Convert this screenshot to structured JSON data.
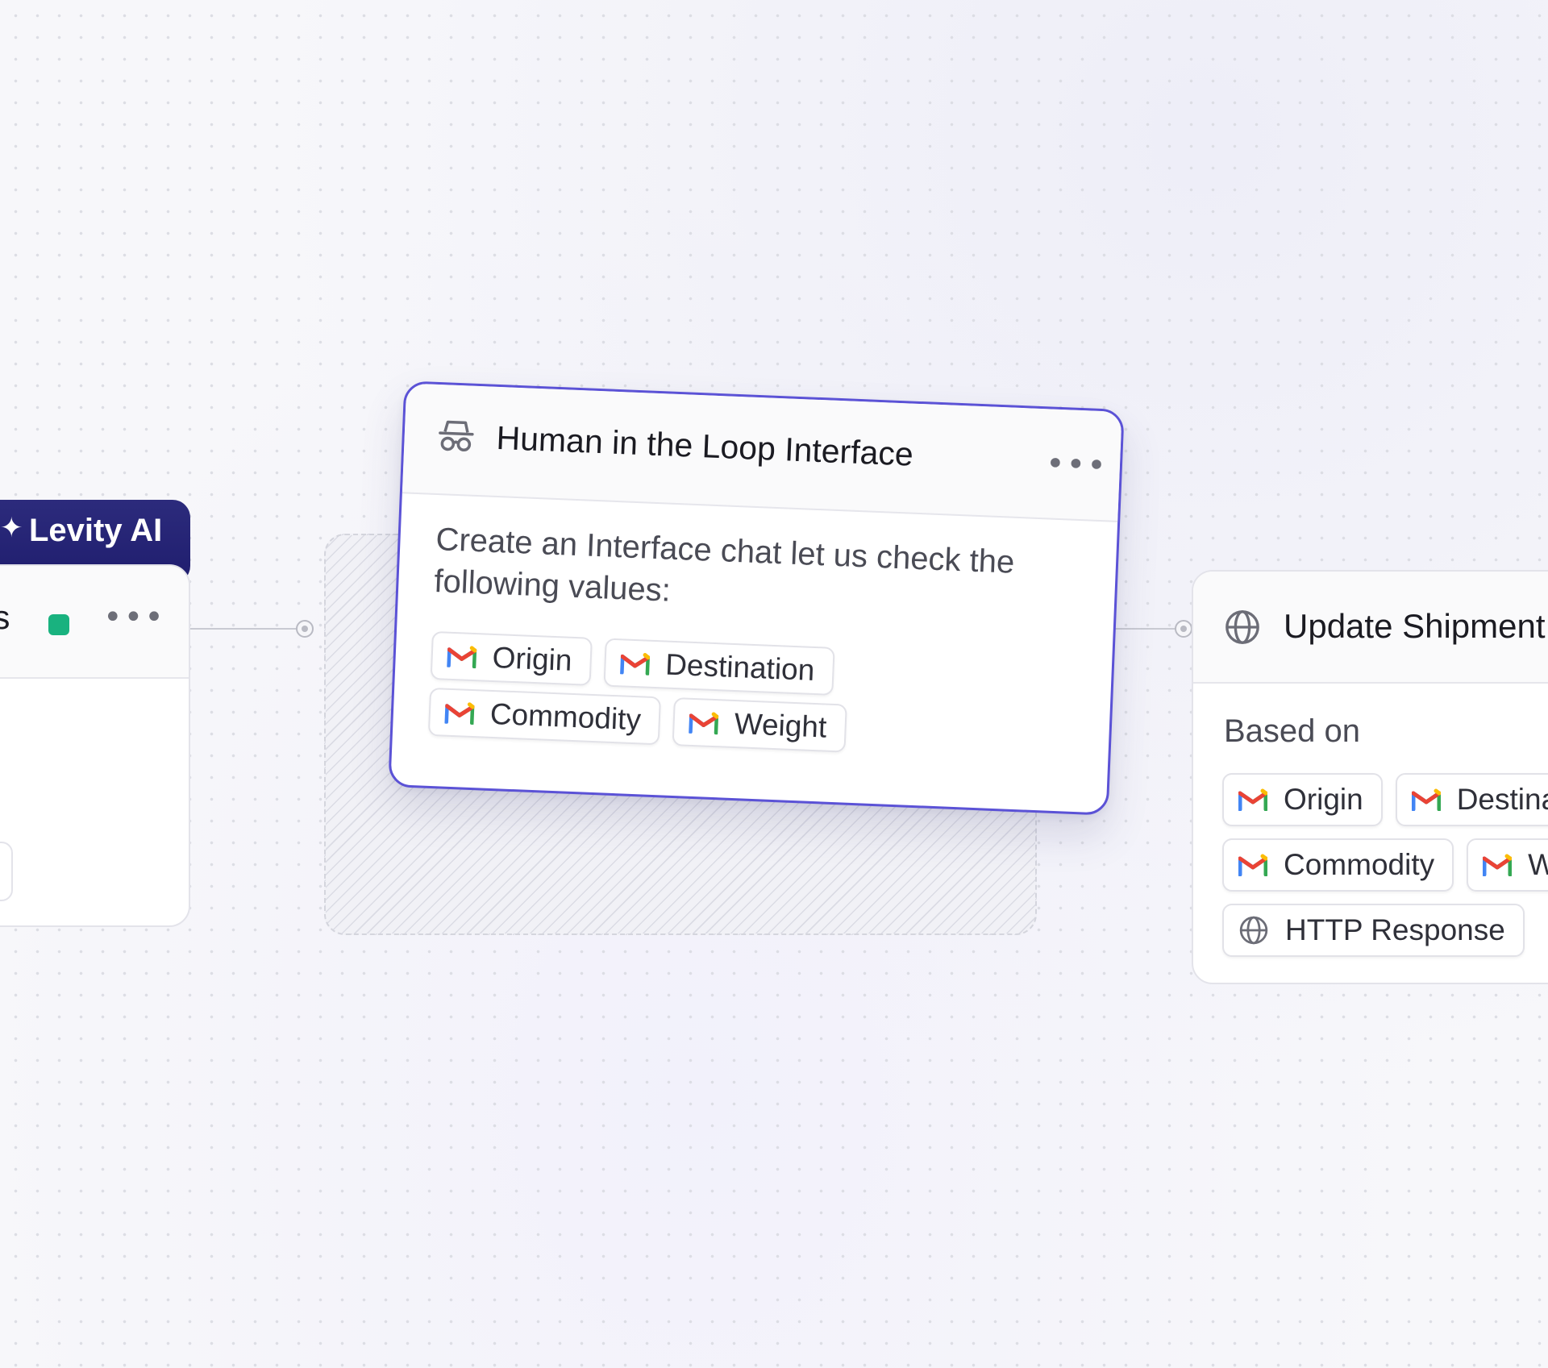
{
  "left_node": {
    "tab_label": "Levity AI",
    "sparkle_glyph": "✦",
    "title_fragment": "ls",
    "status_color": "#19b27f",
    "menu_glyph": "•••"
  },
  "center_node": {
    "title": "Human in the Loop Interface",
    "icon": "incognito-icon",
    "menu_glyph": "•••",
    "description": "Create an Interface chat let us check the following values:",
    "border_color": "#5b52d6",
    "chips_row_1": [
      {
        "label": "Origin",
        "icon": "gmail-icon"
      },
      {
        "label": "Destination",
        "icon": "gmail-icon"
      }
    ],
    "chips_row_2": [
      {
        "label": "Commodity",
        "icon": "gmail-icon"
      },
      {
        "label": "Weight",
        "icon": "gmail-icon"
      }
    ]
  },
  "right_node": {
    "title": "Update Shipment",
    "icon": "globe-icon",
    "section_label": "Based on",
    "chips_row_1": [
      {
        "label": "Origin",
        "icon": "gmail-icon"
      },
      {
        "label": "Destination",
        "icon": "gmail-icon"
      }
    ],
    "chips_row_2": [
      {
        "label": "Commodity",
        "icon": "gmail-icon"
      },
      {
        "label": "Weight",
        "icon": "gmail-icon"
      }
    ],
    "chips_row_3": [
      {
        "label": "HTTP Response",
        "icon": "globe-icon"
      }
    ]
  },
  "colors": {
    "accent": "#5b52d6",
    "ai_tab": "#24226f",
    "gmail_red": "#ea4335",
    "gmail_blue": "#4285f4",
    "gmail_green": "#34a853",
    "gmail_yellow": "#fbbc04"
  }
}
